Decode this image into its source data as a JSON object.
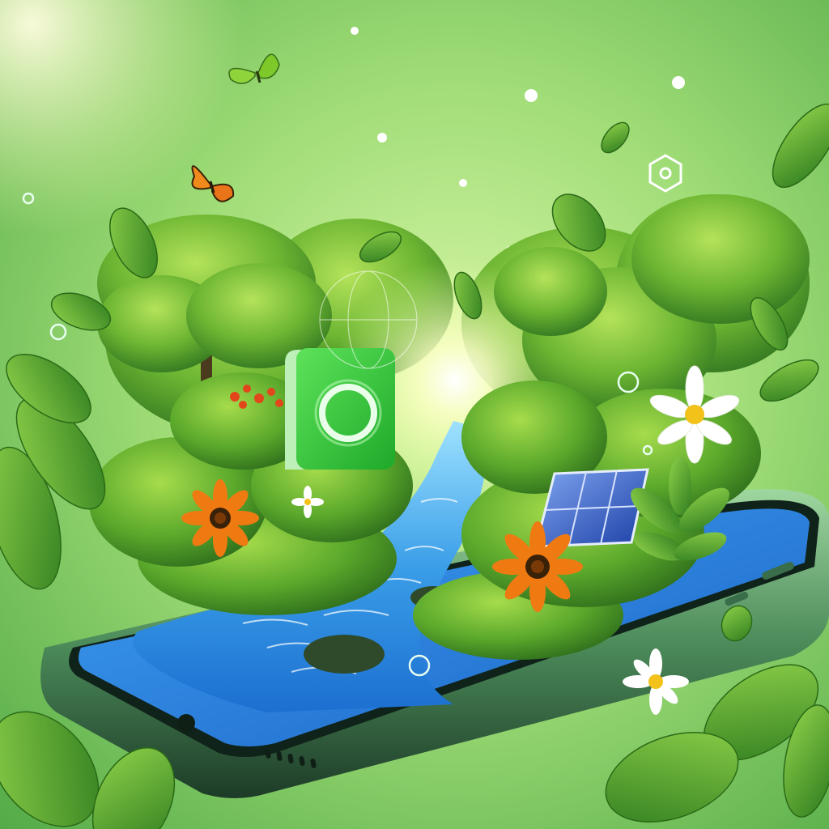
{
  "scene": {
    "type": "illustration",
    "subject": "smartphone-with-nature",
    "colors": {
      "background_light": "#c9ef9a",
      "background_mid": "#86d36b",
      "background_dark": "#3f9a3a",
      "water": "#2f8fe0",
      "water_light": "#8fd8ff",
      "foliage_dark": "#2f7d1f",
      "foliage_mid": "#5fae2e",
      "foliage_light": "#9fd84a",
      "app_icon": "#2fc23a",
      "phone_frame": "#1e3a2a",
      "light_rays": "#7fd8ff",
      "flower_orange": "#f07a12",
      "flower_white": "#ffffff",
      "solar_panel": "#2b56c4"
    },
    "icons": [
      "app-ring-icon",
      "hexagon-icon",
      "butterfly-icon",
      "solar-panel-icon",
      "sun-glow-icon"
    ]
  }
}
